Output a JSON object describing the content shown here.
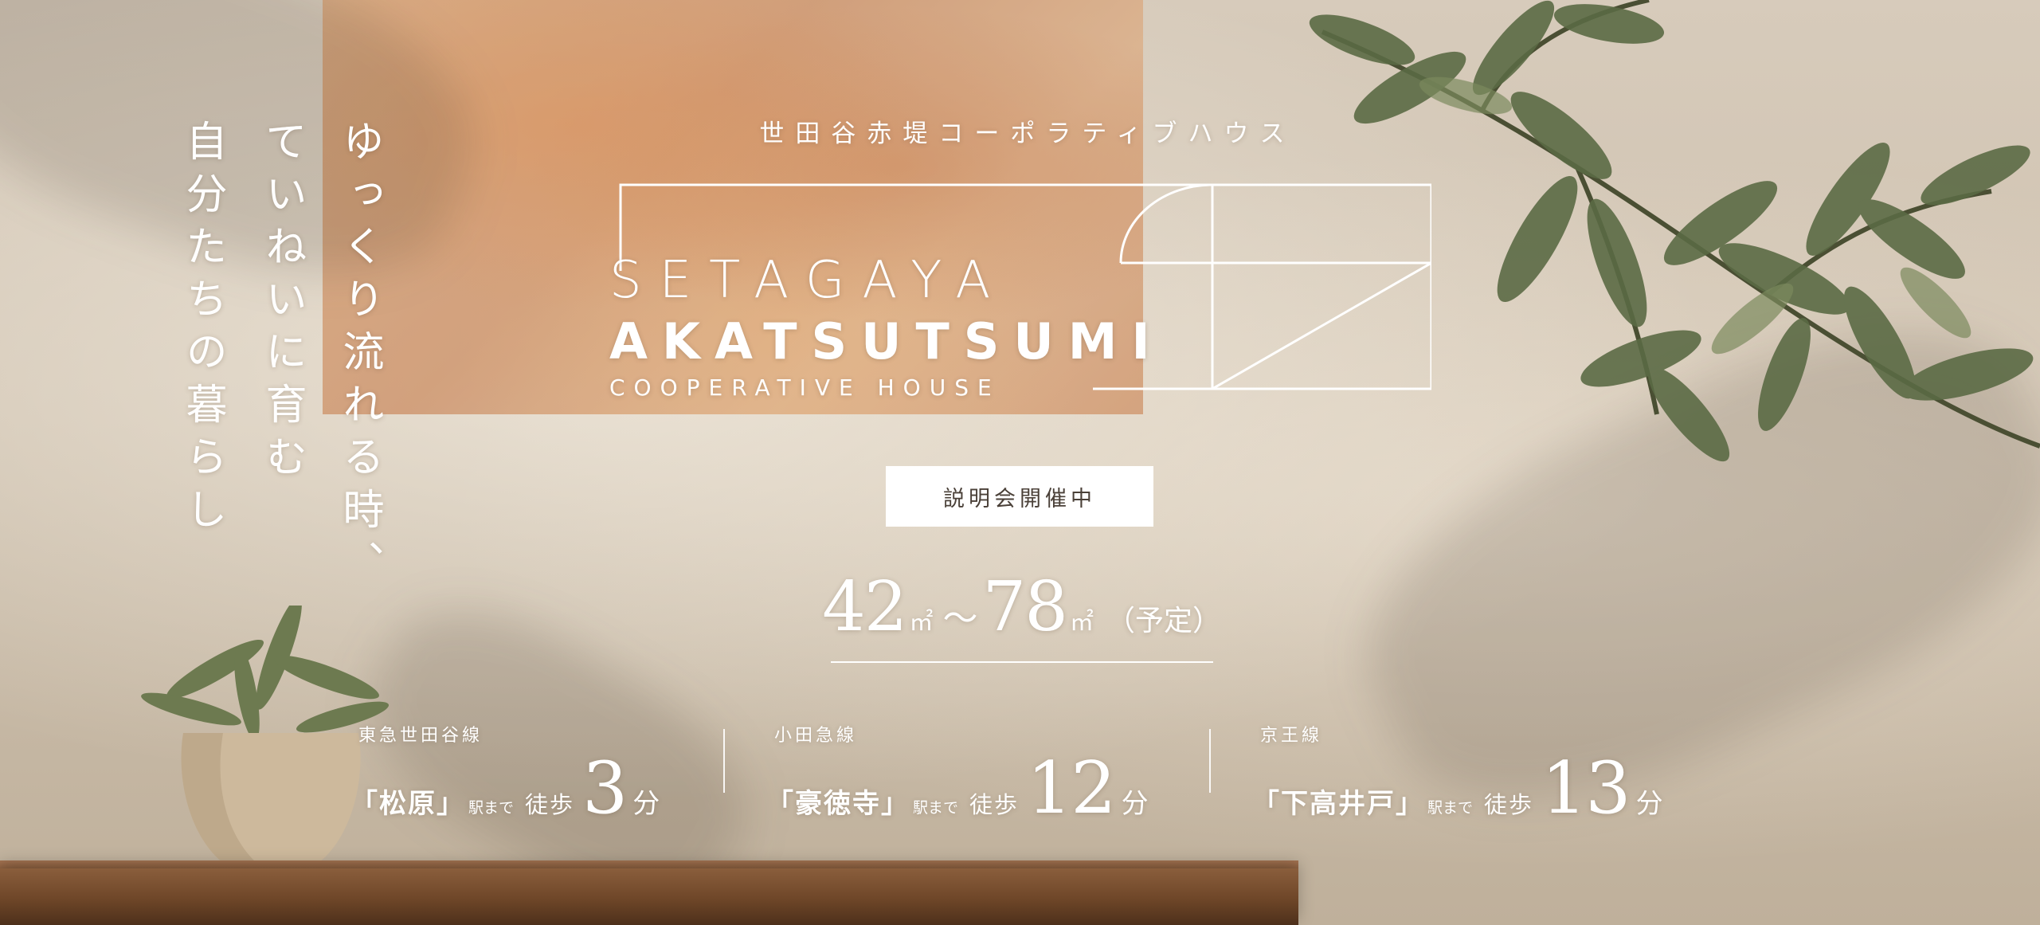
{
  "tagline": {
    "line1": "ゆっくり流れる時、",
    "line2": "ていねいに育む",
    "line3": "自分たちの暮らし"
  },
  "title_jp": "世田谷赤堤コーポラティブハウス",
  "logo": {
    "line1": "SETAGAYA",
    "line2": "AKATSUTSUMI",
    "line3": "COOPERATIVE HOUSE"
  },
  "event_badge": "説明会開催中",
  "area": {
    "min": "42",
    "max": "78",
    "unit": "㎡",
    "tilde": "～",
    "note": "（予定）"
  },
  "stations": [
    {
      "line": "東急世田谷線",
      "name": "「松原」",
      "made": "駅まで",
      "walk": "徒歩",
      "minutes": "3",
      "fun": "分"
    },
    {
      "line": "小田急線",
      "name": "「豪徳寺」",
      "made": "駅まで",
      "walk": "徒歩",
      "minutes": "12",
      "fun": "分"
    },
    {
      "line": "京王線",
      "name": "「下高井戸」",
      "made": "駅まで",
      "walk": "徒歩",
      "minutes": "13",
      "fun": "分"
    }
  ],
  "colors": {
    "wall": "#d7cbbb",
    "text": "#ffffff",
    "badge_text": "#4a4038",
    "leaf": "#5b6a45",
    "shelf": "#6e4628"
  }
}
